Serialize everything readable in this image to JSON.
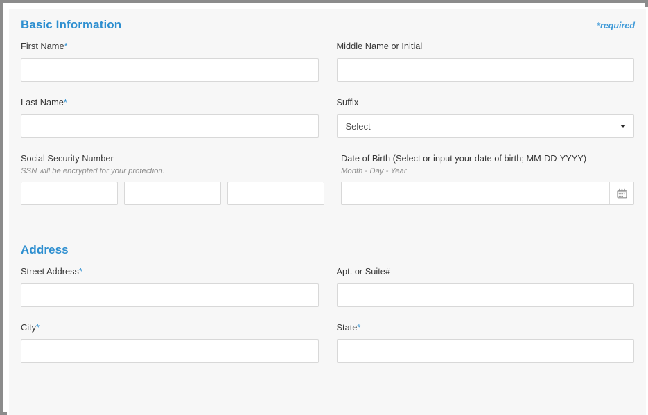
{
  "form": {
    "required_note": "*required",
    "required_marker": "*",
    "sections": [
      {
        "id": "basic-information",
        "title": "Basic Information"
      },
      {
        "id": "address",
        "title": "Address"
      }
    ],
    "fields": {
      "first_name": {
        "label": "First Name",
        "required": true,
        "value": "",
        "placeholder": ""
      },
      "middle_name": {
        "label": "Middle Name or Initial",
        "required": false,
        "value": "",
        "placeholder": ""
      },
      "last_name": {
        "label": "Last Name",
        "required": true,
        "value": "",
        "placeholder": ""
      },
      "suffix": {
        "label": "Suffix",
        "required": false,
        "selected": "Select",
        "icon": "chevron-down-icon"
      },
      "ssn": {
        "label": "Social Security Number",
        "required": false,
        "hint": "SSN will be encrypted for your protection.",
        "part1": "",
        "part2": "",
        "part3": ""
      },
      "date_of_birth": {
        "label": "Date of Birth (Select or input your date of birth; MM-DD-YYYY)",
        "required": false,
        "hint": "Month - Day - Year",
        "value": "",
        "placeholder": "",
        "icon": "calendar-icon"
      },
      "street_address": {
        "label": "Street Address",
        "required": true,
        "value": "",
        "placeholder": ""
      },
      "apt_suite": {
        "label": "Apt. or Suite#",
        "required": false,
        "value": "",
        "placeholder": ""
      },
      "city": {
        "label": "City",
        "required": true,
        "value": "",
        "placeholder": ""
      },
      "state": {
        "label": "State",
        "required": true,
        "value": "",
        "placeholder": ""
      }
    },
    "colors": {
      "accent": "#2e8fd0",
      "required_note": "#3f9ad8",
      "label": "#363636",
      "hint": "#8f8f8f",
      "surface": "#f7f7f7",
      "input_border": "#d8d8d8",
      "frame": "#8c8c8c"
    }
  }
}
